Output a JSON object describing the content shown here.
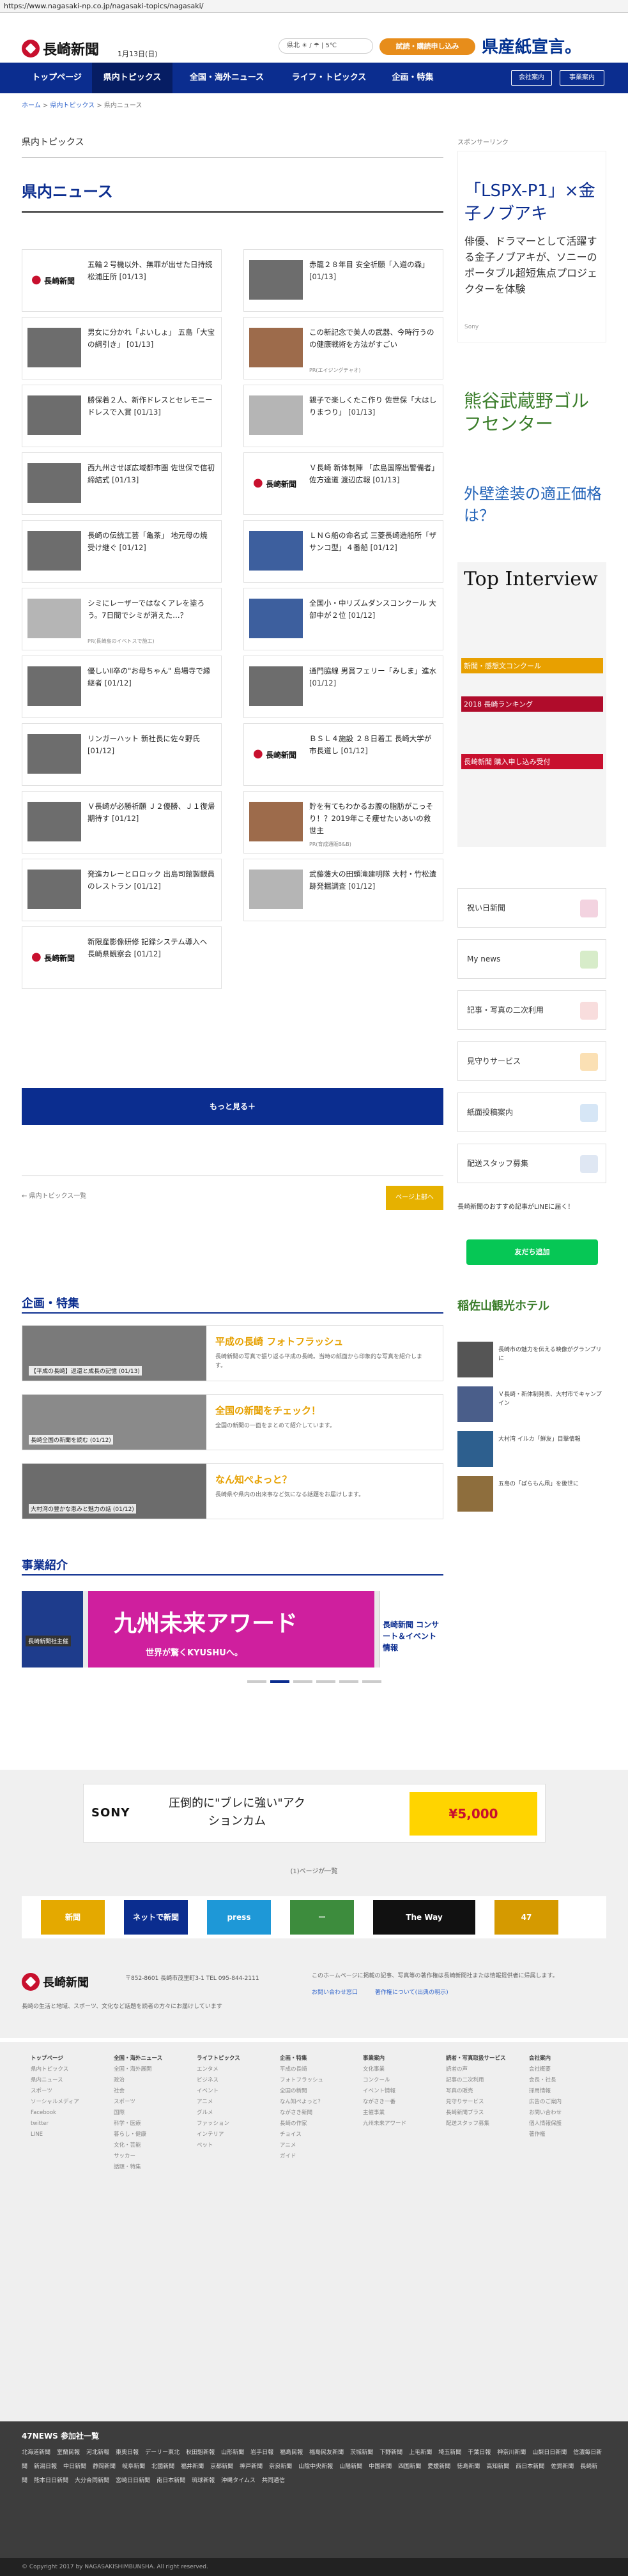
{
  "browser": {
    "url": "https://www.nagasaki-np.co.jp/nagasaki-topics/nagasaki/"
  },
  "header": {
    "logo_text": "長崎新聞",
    "date": "1月13日(日)",
    "weather_text": "県北 ☀ / ☂ | 5℃",
    "trial_button": "試読・購読申し込み",
    "banner_text": "県産紙宣言。"
  },
  "nav": {
    "items": [
      "トップページ",
      "県内トピックス",
      "全国・海外ニュース",
      "ライフ・トピックス",
      "企画・特集"
    ],
    "active": 1,
    "util": [
      "会社案内",
      "事業案内"
    ]
  },
  "breadcrumb": {
    "home": "ホーム",
    "parent": "県内トピックス",
    "current": "県内ニュース"
  },
  "page": {
    "subtitle": "県内トピックス",
    "title": "県内ニュース"
  },
  "news": [
    {
      "title": "五輪２号機以外、無罪が出せた日持続 松浦圧所",
      "date": "[01/13]",
      "thumb": "logo"
    },
    {
      "title": "赤籠２８年目 安全祈願「入道の森」",
      "date": "[01/13]",
      "thumb": "gray"
    },
    {
      "title": "男女に分かれ「よいしょ」 五島「大宝の綱引き」",
      "date": "[01/13]",
      "thumb": "gray"
    },
    {
      "title": "この新記念で美人の武器、今時行うのの健康戦術を方法がすごい",
      "date": "",
      "note": "PR(エイジングチャオ)",
      "thumb": "warm"
    },
    {
      "title": "勝保着２人、新作ドレスとセレモニードレスで入賞",
      "date": "[01/13]",
      "thumb": "gray"
    },
    {
      "title": "親子で楽しくたこ作り 佐世保「大はしりまつり」",
      "date": "[01/13]",
      "thumb": "light"
    },
    {
      "title": "西九州させぼ広域都市圏 佐世保で信初締結式",
      "date": "[01/13]",
      "thumb": "gray"
    },
    {
      "title": "Ｖ長崎 新体制陣 「広島国際出警備者」佐方達道 渡辺広報",
      "date": "[01/13]",
      "thumb": "logo"
    },
    {
      "title": "長崎の伝統工芸「亀茶」 地元母の焼 受け継ぐ",
      "date": "[01/12]",
      "thumb": "gray"
    },
    {
      "title": "ＬＮＧ船の命名式 三菱長崎造船所「ザサンコ型」４番船",
      "date": "[01/12]",
      "thumb": "blue"
    },
    {
      "title": "シミにレーザーではなくアレを塗ろう。7日間でシミが消えた…？",
      "date": "",
      "note": "PR(長崎島のイベトスで施工)",
      "thumb": "light"
    },
    {
      "title": "全国小・中リズムダンスコンクール 大部中が２位",
      "date": "[01/12]",
      "thumb": "blue"
    },
    {
      "title": "優しいⅡ卒の\"お母ちゃん\" 島場寺で縁継者",
      "date": "[01/12]",
      "thumb": "gray"
    },
    {
      "title": "通門脇線 男賞フェリー「みしま」進水",
      "date": "[01/12]",
      "thumb": "gray"
    },
    {
      "title": "リンガーハット 新社長に佐々野氏",
      "date": "[01/12]",
      "thumb": "gray"
    },
    {
      "title": "ＢＳＬ４施設 ２８日着工 長崎大学が市長道し",
      "date": "[01/12]",
      "thumb": "logo"
    },
    {
      "title": "Ｖ長崎が必勝祈願 Ｊ２優勝、Ｊ１復帰期待す",
      "date": "[01/12]",
      "thumb": "gray"
    },
    {
      "title": "貯を有てもわかるお腹の脂肪がこっそり！？2019年こそ痩せたいあいの救世主",
      "date": "",
      "note": "PR(育成通販B&B)",
      "thumb": "warm"
    },
    {
      "title": "発進カレーとロロック 出島司館製銀員のレストラン",
      "date": "[01/12]",
      "thumb": "gray"
    },
    {
      "title": "武藤藩大の田頭滝建明隊 大村・竹松遺跡発掘調査",
      "date": "[01/12]",
      "thumb": "light"
    },
    {
      "title": "新限産影像研修 記録システム導入へ 長崎県観察会",
      "date": "[01/12]",
      "thumb": "logo"
    }
  ],
  "more_button": "もっと見る＋",
  "back_link": "← 県内トピックス一覧",
  "top_button": "ページ上部へ",
  "features": {
    "title": "企画・特集",
    "items": [
      {
        "caption": "【平成の長崎】返還と成長の記憶 (01/13)",
        "title": "平成の長崎 フォトフラッシュ",
        "desc": "長崎新聞の写真で振り返る平成の長崎。当時の紙面から印象的な写真を紹介します。"
      },
      {
        "caption": "長崎全国の新聞を読む (01/12)",
        "title": "全国の新聞をチェック！",
        "desc": "全国の新聞の一面をまとめて紹介しています。"
      },
      {
        "caption": "大村湾の豊かな恵みと魅力の話 (01/12)",
        "title": "なん知ぺよっと？",
        "desc": "長崎県や県内の出来事など気になる話題をお届けします。"
      }
    ]
  },
  "events": {
    "title": "事業紹介",
    "left_caption": "長崎新聞社主催",
    "main_line1": "九州未来アワード",
    "main_line2": "世界が驚くKYUSHUへ。",
    "right_text": "長崎新聞 コンサート＆イベント情報"
  },
  "sidebar": {
    "sponsored": "スポンサーリンク",
    "ad1_big": "「LSPX-P1」×金子ノブアキ",
    "ad1_text": "俳優、ドラマーとして活躍する金子ノブアキが、ソニーのポータブル超短焦点プロジェクターを体験",
    "ad1_by": "Sony",
    "ad2": "熊谷武蔵野ゴルフセンター",
    "ad3": "外壁塗装の適正価格は？",
    "ad4_title": "Top Interview",
    "ad4_blocks": [
      "新聞・感想文コンクール",
      "2018 長崎ランキング",
      "長崎新聞 購入申し込み受付"
    ],
    "links": [
      "祝い日新聞",
      "My news",
      "記事・写真の二次利用",
      "見守りサービス",
      "紙面投稿案内",
      "配送スタッフ募集"
    ],
    "line_promo": "長崎新聞のおすすめ記事がLINEに届く！",
    "line_button": "友だち追加",
    "ad5": "稲佐山観光ホテル",
    "side_news": [
      "長崎市の魅力を伝える映像がグランプリに",
      "Ｖ長崎・新体制発表、大村市でキャンプイン",
      "大村湾 イルカ「鮮友」目撃情報",
      "五島の「ばらもん凧」を後世に"
    ]
  },
  "sony_ad": {
    "logo": "SONY",
    "mid": "圧倒的に\"ブレに強い\"アクションカム",
    "right": "¥5,000"
  },
  "pager": "(1)ページが一覧",
  "brands": [
    "新聞",
    "ネットで新聞",
    "press",
    "ー",
    "The Way",
    "47"
  ],
  "footer": {
    "logo_text": "長崎新聞",
    "address": "〒852-8601 長崎市茂里町3-1 TEL 095-844-2111",
    "desc": "長崎の生活と地域、スポーツ、文化など話題を読者の方々にお届けしています",
    "right_text": "このホームページに掲載の記事、写真等の著作権は長崎新聞社または情報提供者に帰属します。",
    "links": [
      "お問い合わせ窓口",
      "著作権について(出典の明示)"
    ]
  },
  "sitemap": [
    {
      "head": "トップページ",
      "items": [
        "県内トピックス",
        "県内ニュース",
        "スポーツ",
        "ソーシャルメディア",
        "Facebook",
        "twitter",
        "LINE"
      ]
    },
    {
      "head": "全国・海外ニュース",
      "items": [
        "全国・海外展開",
        "政治",
        "社会",
        "スポーツ",
        "国際",
        "科学・医療",
        "暮らし・健康",
        "文化・芸能",
        "サッカー",
        "話題・特集"
      ]
    },
    {
      "head": "ライフトピックス",
      "items": [
        "エンタメ",
        "ビジネス",
        "イベント",
        "アニメ",
        "グルメ",
        "ファッション",
        "インテリア",
        "ペット"
      ]
    },
    {
      "head": "企画・特集",
      "items": [
        "平成の長崎",
        "フォトフラッシュ",
        "全国の新聞",
        "なん知ぺよっと？",
        "ながさき新聞",
        "長崎の作家",
        "チョイス",
        "アニメ",
        "ガイド"
      ]
    },
    {
      "head": "事業案内",
      "items": [
        "文化事業",
        "コンクール",
        "イベント情報",
        "ながさき一番",
        "主催事業",
        "九州未来アワード"
      ]
    },
    {
      "head": "読者・写真取扱サービス",
      "items": [
        "読者の声",
        "記事の二次利用",
        "写真の販売",
        "見守りサービス",
        "長崎新聞プラス",
        "配送スタッフ募集"
      ]
    },
    {
      "head": "会社案内",
      "items": [
        "会社概要",
        "会長・社長",
        "採用情報",
        "広告のご案内",
        "お問い合わせ",
        "個人情報保護",
        "著作権"
      ]
    }
  ],
  "news47": {
    "title": "47NEWS 参加社一覧",
    "members": [
      "北海道新聞",
      "室蘭民報",
      "河北新報",
      "東奥日報",
      "デーリー東北",
      "秋田魁新報",
      "山形新聞",
      "岩手日報",
      "福島民報",
      "福島民友新聞",
      "茨城新聞",
      "下野新聞",
      "上毛新聞",
      "埼玉新聞",
      "千葉日報",
      "神奈川新聞",
      "山梨日日新聞",
      "信濃毎日新聞",
      "新潟日報",
      "中日新聞",
      "静岡新聞",
      "岐阜新聞",
      "北國新聞",
      "福井新聞",
      "京都新聞",
      "神戸新聞",
      "奈良新聞",
      "山陰中央新報",
      "山陽新聞",
      "中国新聞",
      "四国新聞",
      "愛媛新聞",
      "徳島新聞",
      "高知新聞",
      "西日本新聞",
      "佐賀新聞",
      "長崎新聞",
      "熊本日日新聞",
      "大分合同新聞",
      "宮崎日日新聞",
      "南日本新聞",
      "琉球新報",
      "沖縄タイムス",
      "共同通信"
    ]
  },
  "copyright": "© Copyright 2017 by NAGASAKISHIMBUNSHA. All right reserved."
}
